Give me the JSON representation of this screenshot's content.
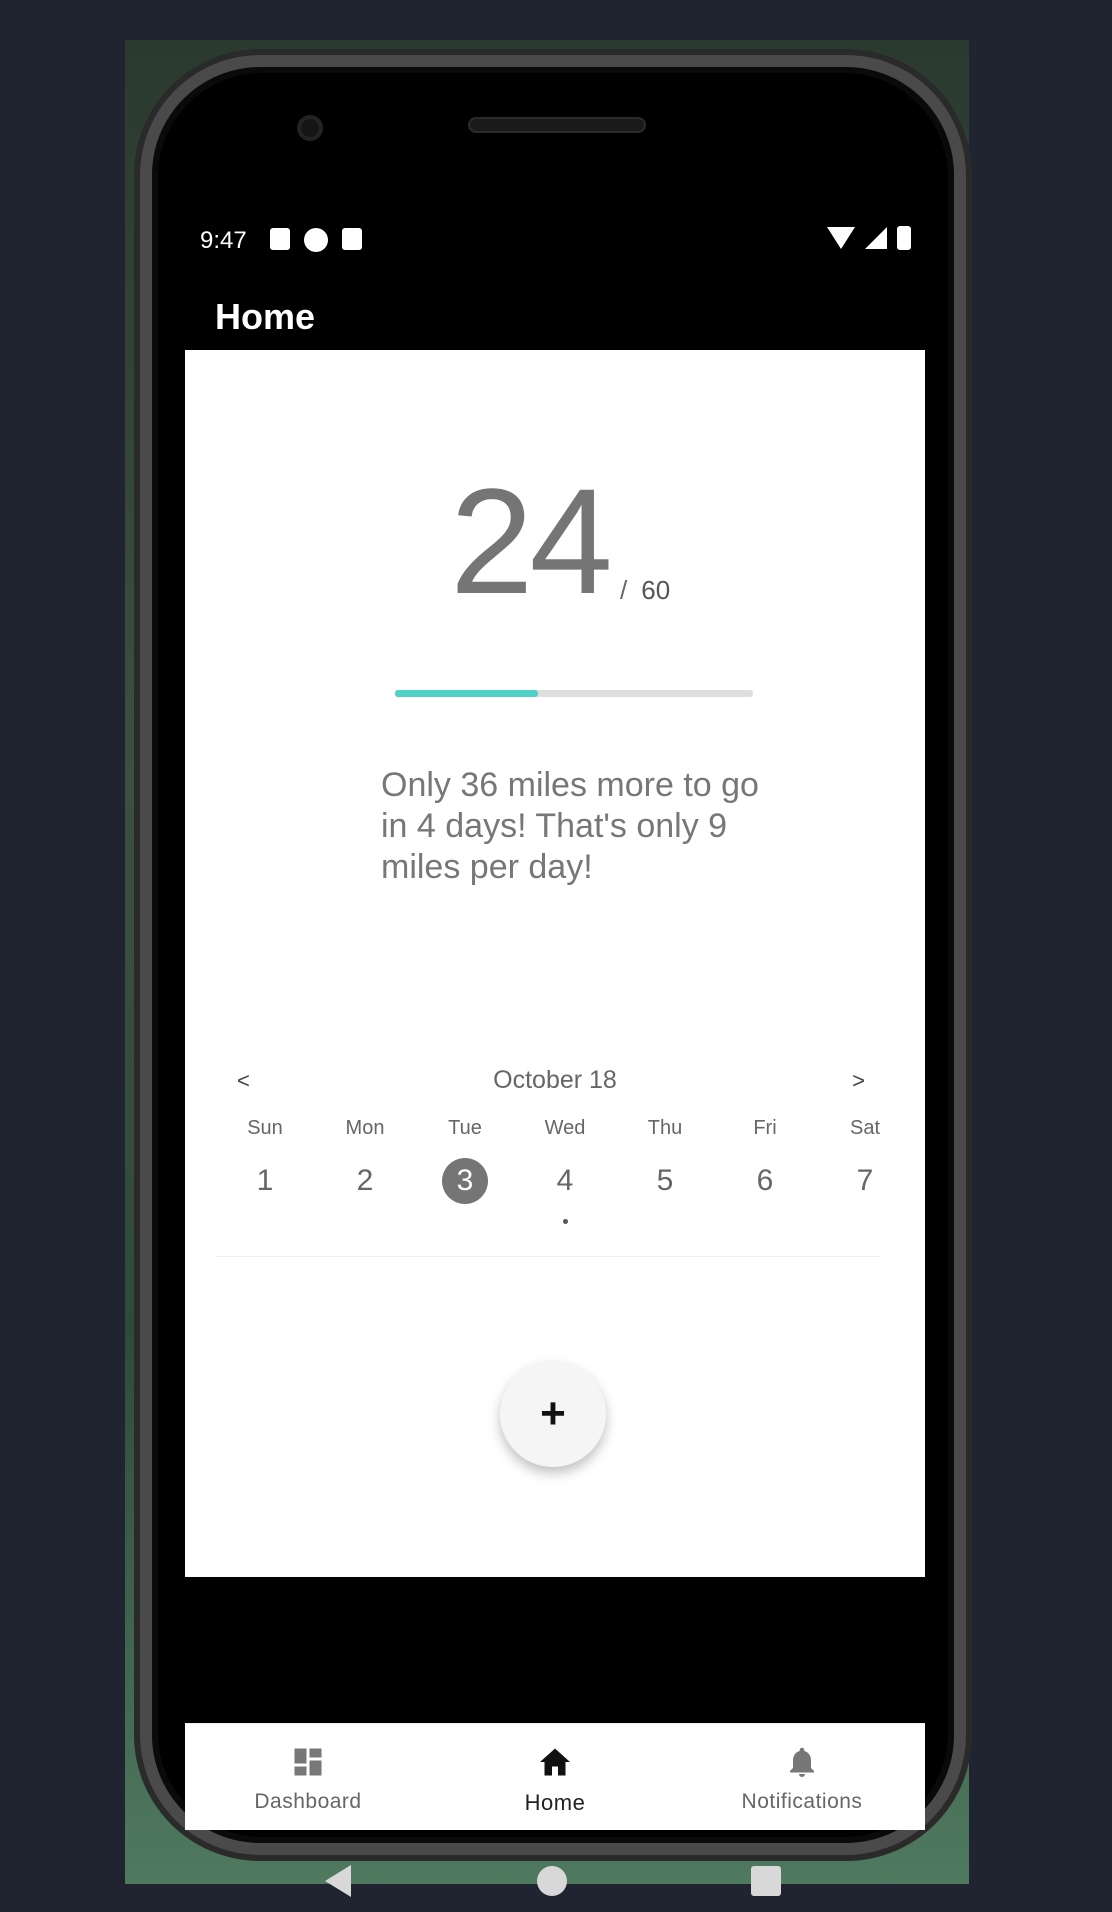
{
  "status_bar": {
    "time": "9:47"
  },
  "app_bar": {
    "title": "Home"
  },
  "progress": {
    "current": "24",
    "separator": "/",
    "goal": "60",
    "fraction": 0.4,
    "accent_color": "#4fd1c5"
  },
  "message": "Only 36 miles more to go in 4 days! That's only 9 miles per day!",
  "calendar": {
    "prev": "<",
    "next": ">",
    "month": "October 18",
    "days": [
      {
        "dow": "Sun",
        "num": "1"
      },
      {
        "dow": "Mon",
        "num": "2"
      },
      {
        "dow": "Tue",
        "num": "3"
      },
      {
        "dow": "Wed",
        "num": "4"
      },
      {
        "dow": "Thu",
        "num": "5"
      },
      {
        "dow": "Fri",
        "num": "6"
      },
      {
        "dow": "Sat",
        "num": "7"
      }
    ],
    "selected": "3",
    "marked": "4"
  },
  "fab": {
    "label": "+"
  },
  "bottom_nav": {
    "items": [
      {
        "label": "Dashboard",
        "icon": "dashboard-icon"
      },
      {
        "label": "Home",
        "icon": "home-icon"
      },
      {
        "label": "Notifications",
        "icon": "bell-icon"
      }
    ],
    "active": "Home"
  }
}
